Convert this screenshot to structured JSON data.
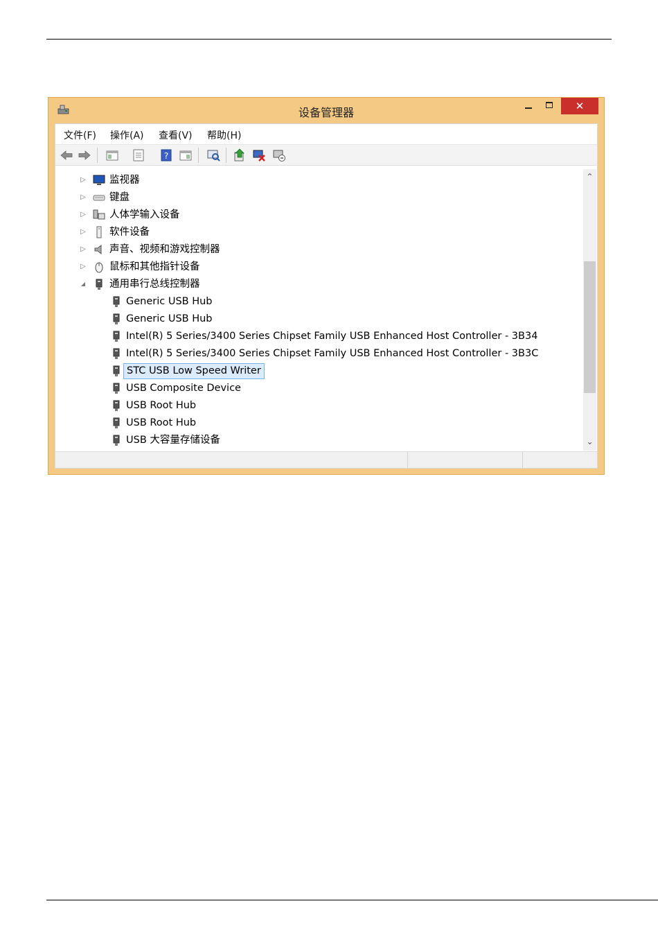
{
  "window": {
    "title": "设备管理器",
    "close_glyph": "✕",
    "accent": "#f4c983",
    "close_color": "#c9302c"
  },
  "menu": [
    {
      "label": "文件(F)"
    },
    {
      "label": "操作(A)"
    },
    {
      "label": "查看(V)"
    },
    {
      "label": "帮助(H)"
    }
  ],
  "toolbar": [
    {
      "icon": "back-arrow-icon"
    },
    {
      "icon": "forward-arrow-icon"
    },
    {
      "icon": "show-hide-console-tree-icon"
    },
    {
      "icon": "properties-icon"
    },
    {
      "icon": "help-icon"
    },
    {
      "icon": "show-action-pane-icon"
    },
    {
      "icon": "scan-hardware-icon"
    },
    {
      "icon": "update-driver-icon"
    },
    {
      "icon": "uninstall-device-icon"
    },
    {
      "icon": "disable-device-icon"
    }
  ],
  "tree": {
    "categories": [
      {
        "label": "监视器",
        "state": "collapsed",
        "icon": "monitor-icon"
      },
      {
        "label": "键盘",
        "state": "collapsed",
        "icon": "keyboard-icon"
      },
      {
        "label": "人体学输入设备",
        "state": "collapsed",
        "icon": "hid-icon"
      },
      {
        "label": "软件设备",
        "state": "collapsed",
        "icon": "software-device-icon"
      },
      {
        "label": "声音、视频和游戏控制器",
        "state": "collapsed",
        "icon": "speaker-icon"
      },
      {
        "label": "鼠标和其他指针设备",
        "state": "collapsed",
        "icon": "mouse-icon"
      },
      {
        "label": "通用串行总线控制器",
        "state": "expanded",
        "icon": "usb-plug-icon"
      }
    ],
    "usb_children": [
      {
        "label": "Generic USB Hub"
      },
      {
        "label": "Generic USB Hub"
      },
      {
        "label": "Intel(R) 5 Series/3400 Series Chipset Family USB Enhanced Host Controller - 3B34"
      },
      {
        "label": "Intel(R) 5 Series/3400 Series Chipset Family USB Enhanced Host Controller - 3B3C"
      },
      {
        "label": "STC USB Low Speed Writer",
        "selected": true
      },
      {
        "label": "USB Composite Device"
      },
      {
        "label": "USB Root Hub"
      },
      {
        "label": "USB Root Hub"
      },
      {
        "label": "USB 大容量存储设备"
      }
    ],
    "collapsed_glyph": "▷",
    "expanded_glyph": "◢"
  },
  "scrollbar": {
    "up_glyph": "⌃",
    "down_glyph": "⌄"
  }
}
